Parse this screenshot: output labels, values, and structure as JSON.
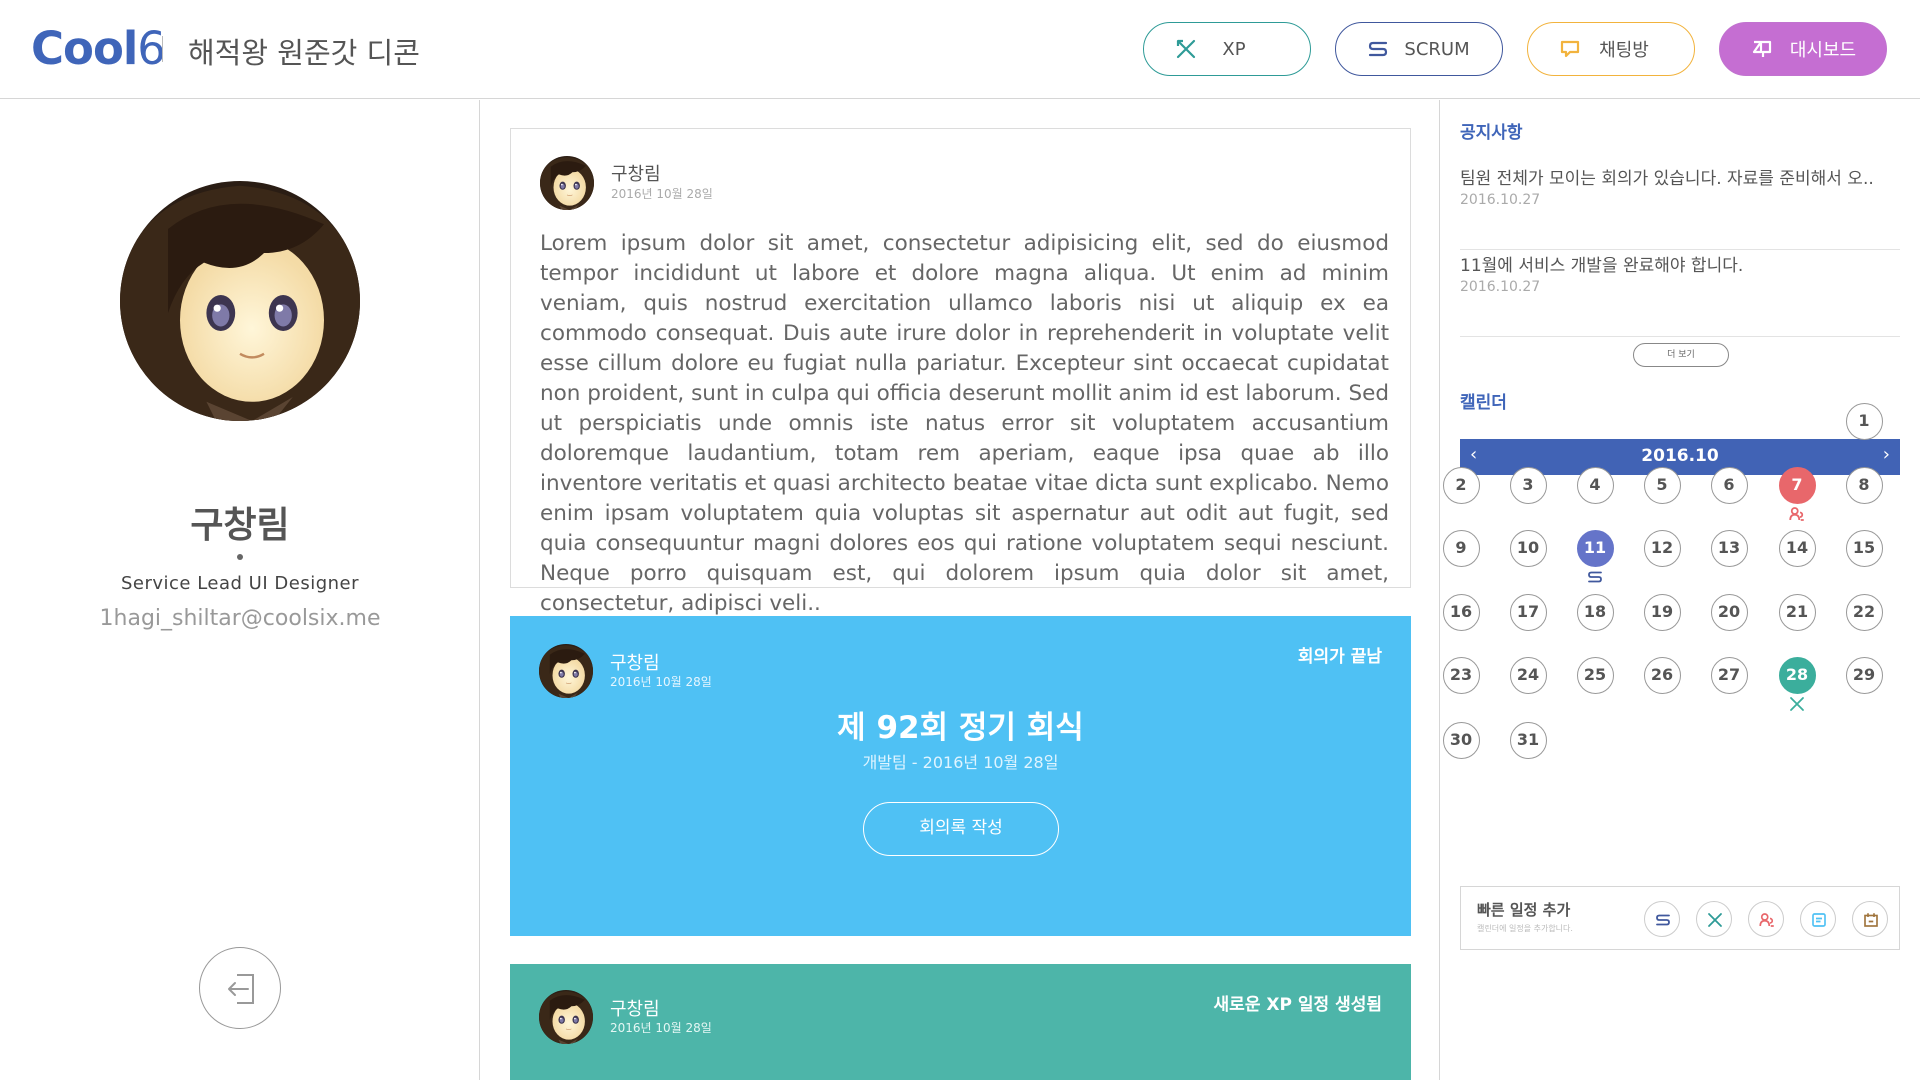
{
  "header": {
    "logo_main": "Cool",
    "logo_num": "6",
    "project_title": "해적왕 원준갓 디콘",
    "nav": {
      "xp": "XP",
      "scrum": "SCRUM",
      "chat": "채팅방",
      "dashboard": "대시보드"
    }
  },
  "colors": {
    "brand": "#3f65b9",
    "xp": "#2e9b97",
    "scrum": "#40589d",
    "chat": "#f2b33d",
    "dashboard": "#c56ed2",
    "meeting_card": "#4fc1f4",
    "xp_card": "#4db5a9",
    "calendar_red": "#e8676b",
    "calendar_blue": "#6574c9",
    "calendar_teal": "#3bae9c"
  },
  "profile": {
    "name": "구창림",
    "role": "Service Lead UI Designer",
    "email": "1hagi_shiltar@coolsix.me",
    "logout_icon": "logout-icon"
  },
  "feed": {
    "post": {
      "author": "구창림",
      "date": "2016년 10월 28일",
      "body": "Lorem ipsum dolor sit amet, consectetur adipisicing elit, sed do eiusmod tempor incididunt ut labore et dolore magna aliqua. Ut enim ad minim veniam, quis nostrud exercitation ullamco laboris nisi ut aliquip ex ea commodo consequat. Duis aute irure dolor in reprehenderit in voluptate velit esse cillum dolore eu fugiat nulla pariatur. Excepteur sint occaecat cupidatat non proident, sunt in culpa qui officia deserunt mollit anim id est laborum. Sed ut perspiciatis unde omnis iste natus error sit voluptatem accusantium doloremque laudantium, totam rem aperiam, eaque ipsa quae ab illo inventore veritatis et quasi architecto beatae vitae dicta sunt explicabo. Nemo enim ipsam voluptatem quia voluptas sit aspernatur aut odit aut fugit, sed quia consequuntur magni dolores eos qui ratione voluptatem sequi nesciunt. Neque porro quisquam est, qui dolorem ipsum quia dolor sit amet, consectetur, adipisci veli.."
    },
    "meeting": {
      "author": "구창림",
      "date": "2016년 10월 28일",
      "badge": "회의가 끝남",
      "title": "제 92회 정기 회식",
      "subtitle": "개발팀 - 2016년 10월 28일",
      "button": "회의록 작성"
    },
    "xp_event": {
      "author": "구창림",
      "date": "2016년 10월 28일",
      "badge": "새로운 XP 일정 생성됨"
    }
  },
  "sidebar": {
    "notice_title": "공지사항",
    "notices": [
      {
        "text": "팀원 전체가 모이는 회의가 있습니다. 자료를 준비해서 오..",
        "date": "2016.10.27"
      },
      {
        "text": "11월에 서비스 개발을 완료해야 합니다.",
        "date": "2016.10.27"
      }
    ],
    "more_button": "더 보기",
    "calendar_title": "캘린더",
    "calendar": {
      "month": "2016.10",
      "prev": "‹",
      "next": "›",
      "days": [
        {
          "d": "1",
          "style": "",
          "icon": ""
        },
        {
          "d": "2",
          "style": "",
          "icon": ""
        },
        {
          "d": "3",
          "style": "",
          "icon": ""
        },
        {
          "d": "4",
          "style": "",
          "icon": ""
        },
        {
          "d": "5",
          "style": "",
          "icon": ""
        },
        {
          "d": "6",
          "style": "",
          "icon": ""
        },
        {
          "d": "7",
          "style": "red",
          "icon": "meeting-icon"
        },
        {
          "d": "8",
          "style": "",
          "icon": ""
        },
        {
          "d": "9",
          "style": "",
          "icon": ""
        },
        {
          "d": "10",
          "style": "",
          "icon": ""
        },
        {
          "d": "11",
          "style": "blue",
          "icon": "scrum-icon"
        },
        {
          "d": "12",
          "style": "",
          "icon": ""
        },
        {
          "d": "13",
          "style": "",
          "icon": ""
        },
        {
          "d": "14",
          "style": "",
          "icon": ""
        },
        {
          "d": "15",
          "style": "",
          "icon": ""
        },
        {
          "d": "16",
          "style": "",
          "icon": ""
        },
        {
          "d": "17",
          "style": "",
          "icon": ""
        },
        {
          "d": "18",
          "style": "",
          "icon": ""
        },
        {
          "d": "19",
          "style": "",
          "icon": ""
        },
        {
          "d": "20",
          "style": "",
          "icon": ""
        },
        {
          "d": "21",
          "style": "",
          "icon": ""
        },
        {
          "d": "22",
          "style": "",
          "icon": ""
        },
        {
          "d": "23",
          "style": "",
          "icon": ""
        },
        {
          "d": "24",
          "style": "",
          "icon": ""
        },
        {
          "d": "25",
          "style": "",
          "icon": ""
        },
        {
          "d": "26",
          "style": "",
          "icon": ""
        },
        {
          "d": "27",
          "style": "",
          "icon": ""
        },
        {
          "d": "28",
          "style": "teal",
          "icon": "xp-icon"
        },
        {
          "d": "29",
          "style": "",
          "icon": ""
        },
        {
          "d": "30",
          "style": "",
          "icon": ""
        },
        {
          "d": "31",
          "style": "",
          "icon": ""
        }
      ]
    },
    "quick_add": {
      "title": "빠른 일정 추가",
      "subtitle": "캘린더에 일정을 추가합니다.",
      "icons": [
        "scrum-icon",
        "xp-icon",
        "meeting-icon",
        "memo-icon",
        "calendar-icon"
      ]
    }
  }
}
